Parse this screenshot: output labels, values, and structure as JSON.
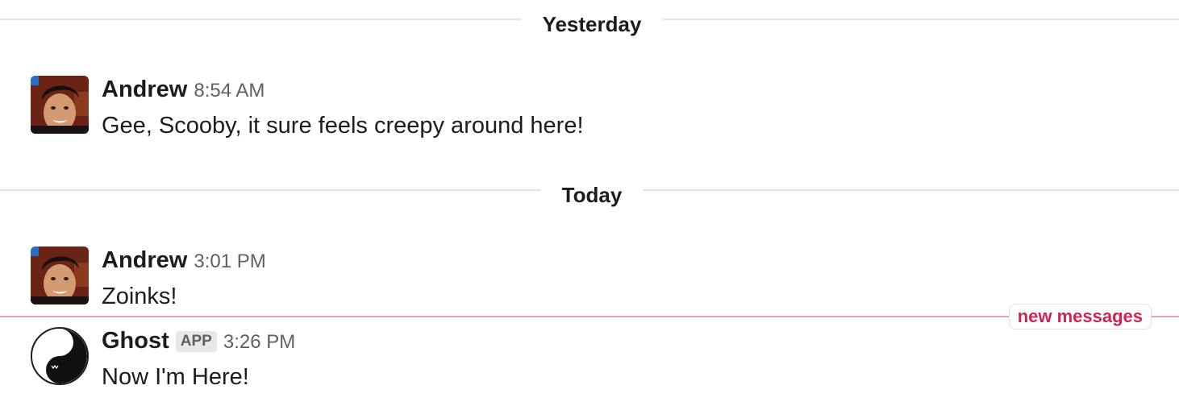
{
  "dividers": {
    "yesterday": "Yesterday",
    "today": "Today"
  },
  "messages": [
    {
      "author": "Andrew",
      "time": "8:54 AM",
      "text": "Gee, Scooby, it sure feels creepy around here!",
      "avatar_icon": "user-photo-avatar"
    },
    {
      "author": "Andrew",
      "time": "3:01 PM",
      "text": "Zoinks!",
      "avatar_icon": "user-photo-avatar"
    },
    {
      "author": "Ghost",
      "badge": "APP",
      "time": "3:26 PM",
      "text": "Now I'm Here!",
      "avatar_icon": "ghost-yin-yang-avatar"
    }
  ],
  "new_messages_label": "new messages",
  "colors": {
    "new_messages_accent": "#cd2553",
    "new_messages_line": "#e8a0b2",
    "divider": "#e2e2e2"
  }
}
